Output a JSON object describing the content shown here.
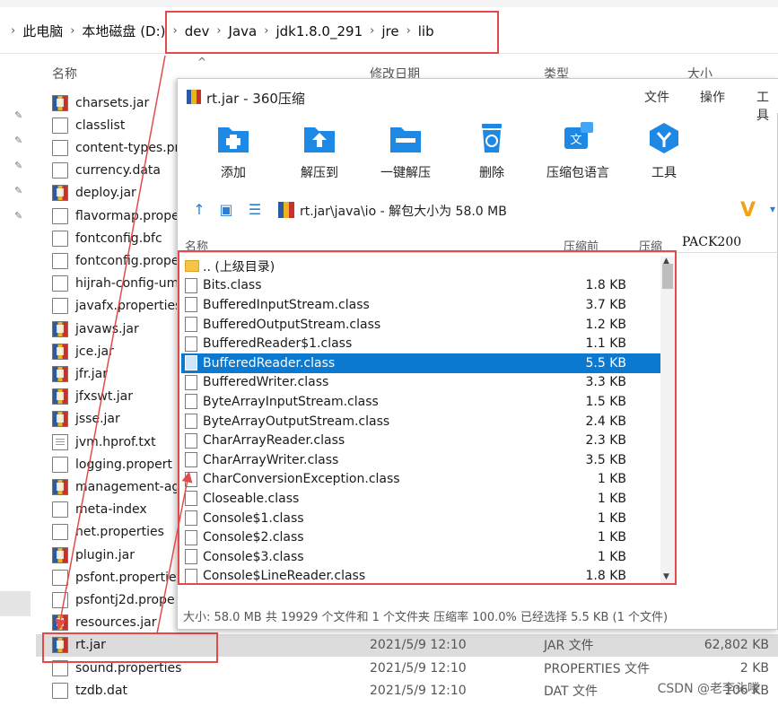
{
  "explorer": {
    "breadcrumb": [
      "此电脑",
      "本地磁盘 (D:)",
      "dev",
      "Java",
      "jdk1.8.0_291",
      "jre",
      "lib"
    ],
    "columns": {
      "name": "名称",
      "date": "修改日期",
      "type": "类型",
      "size": "大小"
    },
    "files": [
      {
        "name": "charsets.jar",
        "icon": "jar"
      },
      {
        "name": "classlist",
        "icon": "doc"
      },
      {
        "name": "content-types.pr",
        "icon": "doc"
      },
      {
        "name": "currency.data",
        "icon": "doc"
      },
      {
        "name": "deploy.jar",
        "icon": "jar"
      },
      {
        "name": "flavormap.prope",
        "icon": "doc"
      },
      {
        "name": "fontconfig.bfc",
        "icon": "doc"
      },
      {
        "name": "fontconfig.prope",
        "icon": "doc"
      },
      {
        "name": "hijrah-config-um",
        "icon": "doc"
      },
      {
        "name": "javafx.properties",
        "icon": "doc"
      },
      {
        "name": "javaws.jar",
        "icon": "jar"
      },
      {
        "name": "jce.jar",
        "icon": "jar"
      },
      {
        "name": "jfr.jar",
        "icon": "jar"
      },
      {
        "name": "jfxswt.jar",
        "icon": "jar"
      },
      {
        "name": "jsse.jar",
        "icon": "jar"
      },
      {
        "name": "jvm.hprof.txt",
        "icon": "txt"
      },
      {
        "name": "logging.propert",
        "icon": "doc"
      },
      {
        "name": "management-ag",
        "icon": "jar"
      },
      {
        "name": "meta-index",
        "icon": "doc"
      },
      {
        "name": "net.properties",
        "icon": "doc"
      },
      {
        "name": "plugin.jar",
        "icon": "jar"
      },
      {
        "name": "psfont.propertie",
        "icon": "doc"
      },
      {
        "name": "psfontj2d.prope",
        "icon": "doc"
      },
      {
        "name": "resources.jar",
        "icon": "jar"
      },
      {
        "name": "rt.jar",
        "icon": "jar",
        "date": "2021/5/9 12:10",
        "type": "JAR 文件",
        "size": "62,802 KB",
        "selected": true
      },
      {
        "name": "sound.properties",
        "icon": "doc",
        "date": "2021/5/9 12:10",
        "type": "PROPERTIES 文件",
        "size": "2 KB"
      },
      {
        "name": "tzdb.dat",
        "icon": "doc",
        "date": "2021/5/9 12:10",
        "type": "DAT 文件",
        "size": "106 KB"
      }
    ],
    "watermark": "CSDN @老李头喽"
  },
  "zip": {
    "title": "rt.jar - 360压缩",
    "menu": [
      "文件",
      "操作",
      "工具"
    ],
    "toolbar": [
      {
        "label": "添加",
        "icon": "add-folder-icon"
      },
      {
        "label": "解压到",
        "icon": "extract-to-icon"
      },
      {
        "label": "一键解压",
        "icon": "one-click-extract-icon"
      },
      {
        "label": "删除",
        "icon": "delete-icon"
      },
      {
        "label": "压缩包语言",
        "icon": "language-icon"
      },
      {
        "label": "工具",
        "icon": "tools-icon"
      }
    ],
    "path": "rt.jar\\java\\io - 解包大小为 58.0 MB",
    "columns": {
      "name": "名称",
      "compressed": "压缩前",
      "after": "压缩"
    },
    "side_label": "PACK200",
    "entries": [
      {
        "name": ".. (上级目录)",
        "size": "",
        "folder": true
      },
      {
        "name": "Bits.class",
        "size": "1.8 KB"
      },
      {
        "name": "BufferedInputStream.class",
        "size": "3.7 KB"
      },
      {
        "name": "BufferedOutputStream.class",
        "size": "1.2 KB"
      },
      {
        "name": "BufferedReader$1.class",
        "size": "1.1 KB"
      },
      {
        "name": "BufferedReader.class",
        "size": "5.5 KB",
        "selected": true
      },
      {
        "name": "BufferedWriter.class",
        "size": "3.3 KB"
      },
      {
        "name": "ByteArrayInputStream.class",
        "size": "1.5 KB"
      },
      {
        "name": "ByteArrayOutputStream.class",
        "size": "2.4 KB"
      },
      {
        "name": "CharArrayReader.class",
        "size": "2.3 KB"
      },
      {
        "name": "CharArrayWriter.class",
        "size": "3.5 KB"
      },
      {
        "name": "CharConversionException.class",
        "size": "1 KB"
      },
      {
        "name": "Closeable.class",
        "size": "1 KB"
      },
      {
        "name": "Console$1.class",
        "size": "1 KB"
      },
      {
        "name": "Console$2.class",
        "size": "1 KB"
      },
      {
        "name": "Console$3.class",
        "size": "1 KB"
      },
      {
        "name": "Console$LineReader.class",
        "size": "1.8 KB"
      }
    ],
    "status": "大小: 58.0 MB 共 19929 个文件和 1 个文件夹 压缩率 100.0% 已经选择 5.5 KB (1 个文件)"
  },
  "colors": {
    "highlight": "#e34b4b",
    "selection": "#0b79d0",
    "accent": "#2a7fd4"
  }
}
